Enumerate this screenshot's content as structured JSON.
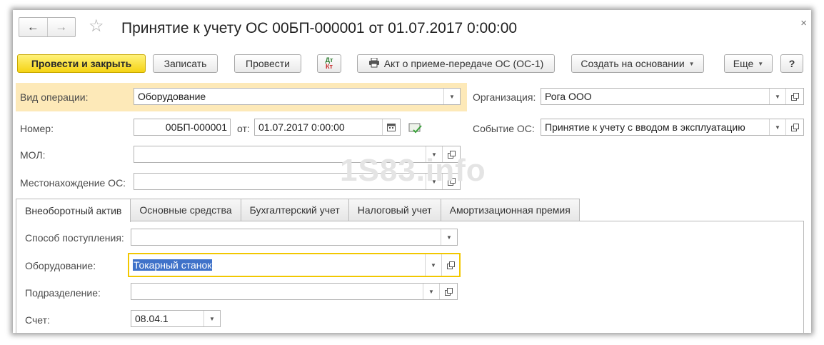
{
  "window": {
    "title": "Принятие к учету ОС 00БП-000001 от 01.07.2017 0:00:00",
    "back_icon": "arrow-left-icon",
    "forward_icon": "arrow-right-icon",
    "favorite_icon": "star-icon",
    "close_label": "×"
  },
  "toolbar": {
    "post_close": "Провести и закрыть",
    "save": "Записать",
    "post": "Провести",
    "dtkt_top": "Дт",
    "dtkt_bottom": "Кт",
    "act_print": "Акт о приеме-передаче ОС (ОС-1)",
    "create_based": "Создать на основании",
    "more": "Еще",
    "help": "?"
  },
  "header": {
    "operation_label": "Вид операции:",
    "operation_value": "Оборудование",
    "org_label": "Организация:",
    "org_value": "Рога ООО",
    "number_label": "Номер:",
    "number_value": "00БП-000001",
    "date_label": "от:",
    "date_value": "01.07.2017  0:00:00",
    "event_label": "Событие ОС:",
    "event_value": "Принятие к учету с вводом в эксплуатацию",
    "mol_label": "МОЛ:",
    "mol_value": "",
    "location_label": "Местонахождение ОС:",
    "location_value": ""
  },
  "watermark": "1S83.info",
  "tabs": [
    {
      "label": "Внеоборотный актив",
      "active": true
    },
    {
      "label": "Основные средства",
      "active": false
    },
    {
      "label": "Бухгалтерский учет",
      "active": false
    },
    {
      "label": "Налоговый учет",
      "active": false
    },
    {
      "label": "Амортизационная премия",
      "active": false
    }
  ],
  "asset_tab": {
    "receipt_method_label": "Способ поступления:",
    "receipt_method_value": "",
    "equipment_label": "Оборудование:",
    "equipment_value": "Токарный станок",
    "department_label": "Подразделение:",
    "department_value": "",
    "account_label": "Счет:",
    "account_value": "08.04.1"
  },
  "colors": {
    "primary_button": "#f5d314",
    "highlight_row": "#fde9b8",
    "focus_border": "#f2c700",
    "selection": "#3f72c9"
  }
}
